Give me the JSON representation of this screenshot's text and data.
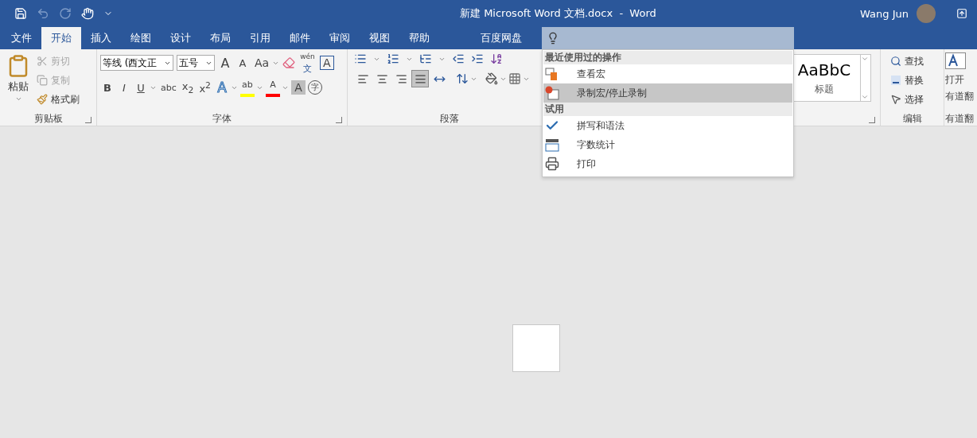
{
  "title_bar": {
    "title": "新建 Microsoft Word 文档.docx  -  Word",
    "user": "Wang Jun"
  },
  "tabs": [
    {
      "label": "文件",
      "selected": false
    },
    {
      "label": "开始",
      "selected": true
    },
    {
      "label": "插入",
      "selected": false
    },
    {
      "label": "绘图",
      "selected": false
    },
    {
      "label": "设计",
      "selected": false
    },
    {
      "label": "布局",
      "selected": false
    },
    {
      "label": "引用",
      "selected": false
    },
    {
      "label": "邮件",
      "selected": false
    },
    {
      "label": "审阅",
      "selected": false
    },
    {
      "label": "视图",
      "selected": false
    },
    {
      "label": "帮助",
      "selected": false
    },
    {
      "label": "百度网盘",
      "selected": false
    }
  ],
  "clipboard": {
    "label": "剪贴板",
    "paste": "粘贴",
    "items": [
      {
        "kind": "cut",
        "label": "剪切",
        "disabled": true
      },
      {
        "kind": "copy",
        "label": "复制",
        "disabled": true
      },
      {
        "kind": "painter",
        "label": "格式刷",
        "disabled": false
      }
    ]
  },
  "font": {
    "label": "字体",
    "font_name": "等线 (西文正",
    "font_size": "五号",
    "tools": [
      {
        "kind": "grow",
        "label": "A"
      },
      {
        "kind": "shrink",
        "label": "A"
      },
      {
        "kind": "case",
        "label": "Aa"
      },
      {
        "kind": "clear"
      },
      {
        "kind": "phonetic",
        "label": "wén",
        "sub": "文"
      },
      {
        "kind": "border",
        "label": "A"
      }
    ],
    "formats": [
      {
        "kind": "plain",
        "label": "B"
      },
      {
        "kind": "plain",
        "label": "I"
      },
      {
        "kind": "underline",
        "label": "U"
      },
      {
        "kind": "plain",
        "label": "abc"
      },
      {
        "kind": "plain",
        "label": "x$_{2}$"
      },
      {
        "kind": "plain",
        "label": "x$^{2}$"
      },
      {
        "kind": "effects",
        "label": "A"
      },
      {
        "kind": "color",
        "label": "ab",
        "color": "#ffff00"
      },
      {
        "kind": "color",
        "label": "A",
        "color": "#ff0000"
      },
      {
        "kind": "shading",
        "label": "A"
      },
      {
        "kind": "enclose",
        "label": "字"
      }
    ]
  },
  "paragraph": {
    "label": "段落",
    "alignments": [
      {
        "selected": false
      },
      {
        "selected": false
      },
      {
        "selected": false
      },
      {
        "selected": true
      },
      {
        "selected": false
      }
    ]
  },
  "styles": {
    "sample": "AaBbC",
    "name": "标题"
  },
  "editing": {
    "label": "编辑",
    "items": [
      {
        "kind": "find",
        "label": "查找"
      },
      {
        "kind": "replace",
        "label": "替换"
      },
      {
        "kind": "select",
        "label": "选择"
      }
    ]
  },
  "translate": {
    "lines": [
      "打开",
      "有道翻"
    ],
    "label": "有道翻"
  },
  "tell_me_menu": {
    "sections": [
      {
        "heading": "最近使用过的操作",
        "items": [
          {
            "kind": "view-macro",
            "label": "查看宏",
            "selected": false
          },
          {
            "kind": "record-macro",
            "label": "录制宏/停止录制",
            "selected": true
          }
        ]
      },
      {
        "heading": "试用",
        "items": [
          {
            "kind": "spelling",
            "label": "拼写和语法",
            "selected": false
          },
          {
            "kind": "word-count",
            "label": "字数统计",
            "selected": false
          },
          {
            "kind": "print",
            "label": "打印",
            "selected": false
          }
        ]
      }
    ]
  }
}
